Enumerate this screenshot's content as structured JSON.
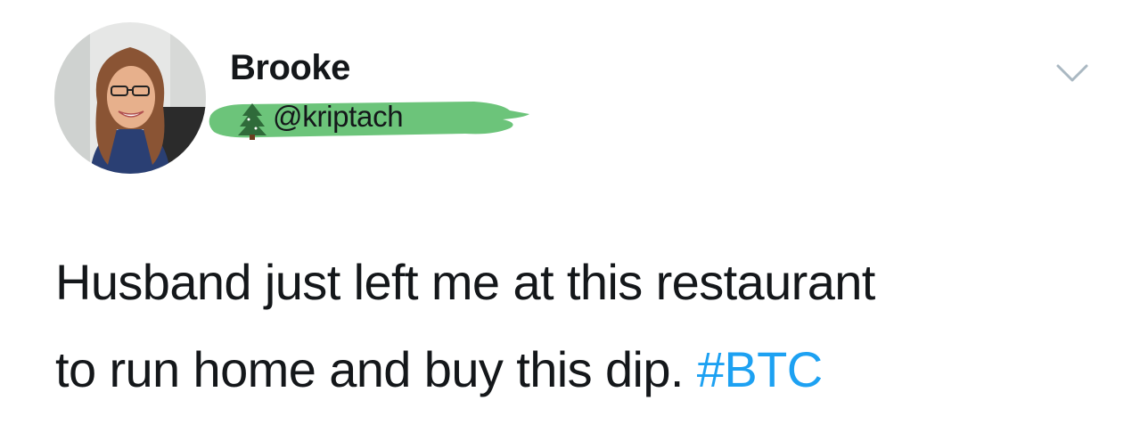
{
  "tweet": {
    "author": {
      "display_name": "Brooke",
      "handle": "@kriptach"
    },
    "text_line1": "Husband just left me at this restaurant",
    "text_line2_prefix": "to run home and buy this dip. ",
    "hashtag": "#BTC",
    "menu_icon": "chevron-down-icon",
    "badge_icon": "christmas-tree-icon"
  },
  "colors": {
    "text": "#14171a",
    "hashtag": "#1da1f2",
    "handle_highlight": "#6cc47a",
    "chevron": "#aab8c2"
  }
}
